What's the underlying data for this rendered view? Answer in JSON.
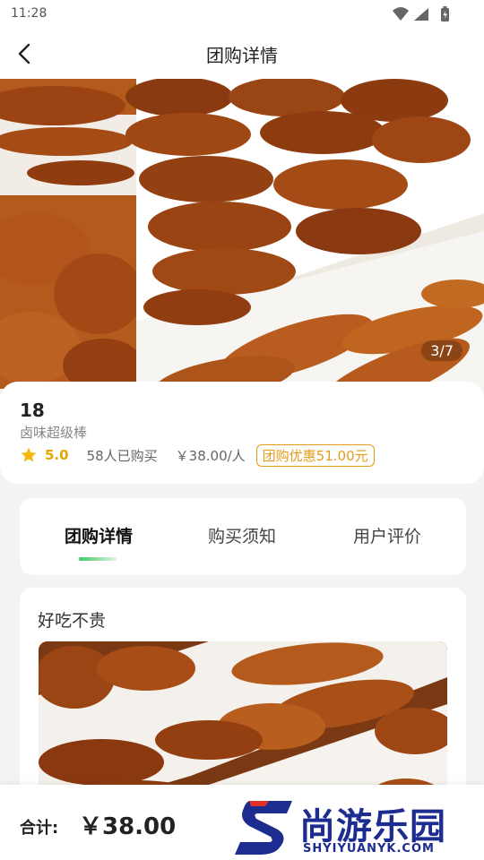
{
  "status_bar": {
    "time": "11:28"
  },
  "nav": {
    "title": "团购详情"
  },
  "gallery": {
    "pager": "3/7"
  },
  "shop": {
    "name": "18",
    "description": "卤味超级棒",
    "rating": "5.0",
    "sold": "58人已购买",
    "price_per_person": "￥38.00/人",
    "discount": "团购优惠51.00元"
  },
  "tabs": [
    {
      "label": "团购详情",
      "active": true
    },
    {
      "label": "购买须知",
      "active": false
    },
    {
      "label": "用户评价",
      "active": false
    }
  ],
  "details": {
    "section_title": "好吃不贵"
  },
  "checkout": {
    "total_label": "合计:",
    "total_price": "￥38.00"
  },
  "watermark": {
    "name": "尚游乐园",
    "url": "SHYIYUANYK.COM"
  },
  "colors": {
    "accent_green": "#42c964",
    "discount_orange": "#e69b1a",
    "rating_gold": "#e6a600",
    "watermark_blue": "#1d2c8f"
  }
}
